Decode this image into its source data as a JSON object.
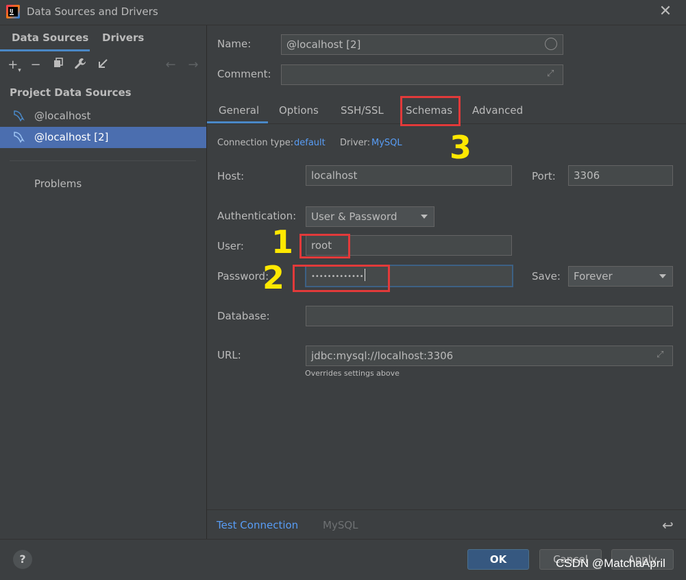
{
  "window": {
    "title": "Data Sources and Drivers"
  },
  "left_panel": {
    "tabs": [
      {
        "label": "Data Sources",
        "active": true
      },
      {
        "label": "Drivers",
        "active": false
      }
    ],
    "toolbar_icons": [
      "add-icon",
      "remove-icon",
      "duplicate-icon",
      "wrench-icon",
      "import-icon",
      "back-arrow-icon",
      "forward-arrow-icon"
    ],
    "section_label": "Project Data Sources",
    "items": [
      {
        "label": "@localhost",
        "selected": false
      },
      {
        "label": "@localhost [2]",
        "selected": true
      }
    ],
    "problems_label": "Problems"
  },
  "form": {
    "name_label": "Name:",
    "name_value": "@localhost [2]",
    "comment_label": "Comment:",
    "comment_value": "",
    "tabs": [
      "General",
      "Options",
      "SSH/SSL",
      "Schemas",
      "Advanced"
    ],
    "active_tab": "General",
    "connection_type_label": "Connection type:",
    "connection_type_value": "default",
    "driver_label": "Driver:",
    "driver_value": "MySQL",
    "host_label": "Host:",
    "host_value": "localhost",
    "port_label": "Port:",
    "port_value": "3306",
    "auth_label": "Authentication:",
    "auth_value": "User & Password",
    "user_label": "User:",
    "user_value": "root",
    "password_label": "Password:",
    "password_value": "•••••••••••••",
    "save_label": "Save:",
    "save_value": "Forever",
    "database_label": "Database:",
    "database_value": "",
    "url_label": "URL:",
    "url_value": "jdbc:mysql://localhost:3306",
    "url_hint": "Overrides settings above"
  },
  "bottom_bar": {
    "test_connection": "Test Connection",
    "driver_name": "MySQL"
  },
  "footer": {
    "help": "?",
    "ok": "OK",
    "cancel": "Cancel",
    "apply": "Apply"
  },
  "annotations": {
    "num1": "1",
    "num2": "2",
    "num3": "3",
    "watermark": "CSDN @MatchaApril"
  },
  "colors": {
    "accent": "#4a88c7",
    "selection": "#4b6eaf",
    "link": "#589df6",
    "annotation_red": "#e23a3a",
    "annotation_yellow": "#ffe800"
  }
}
